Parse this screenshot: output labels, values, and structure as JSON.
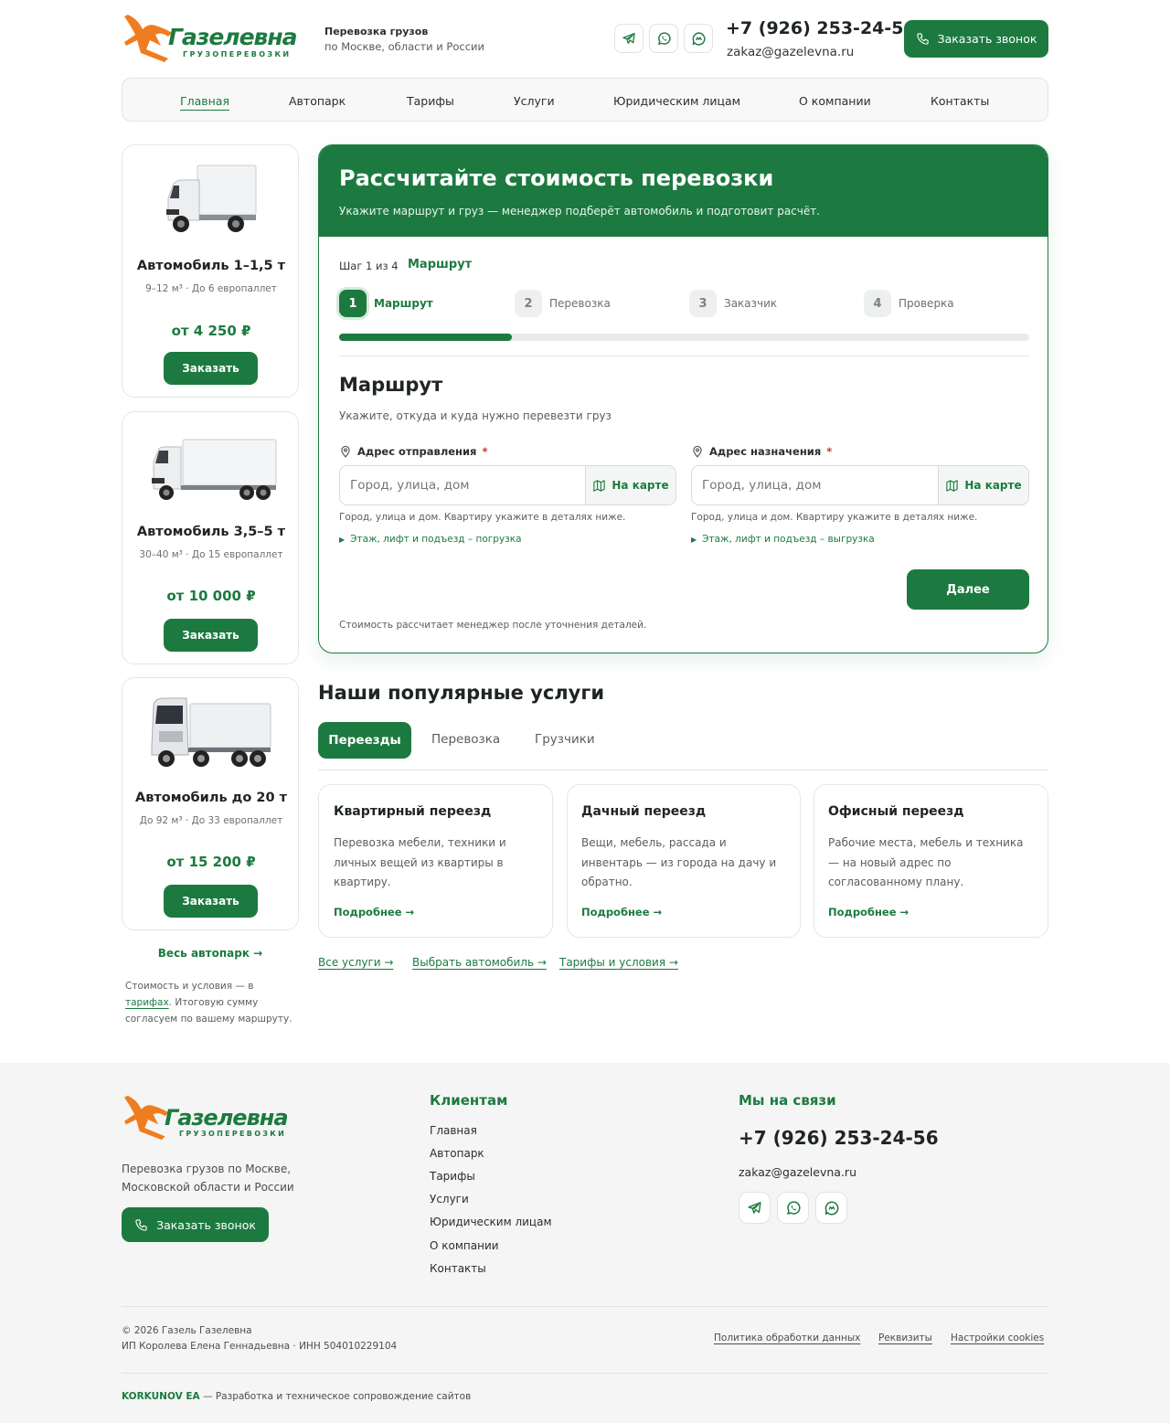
{
  "header": {
    "logo_name": "Газелевна",
    "logo_sub": "ГРУЗОПЕРЕВОЗКИ",
    "tagline_1": "Перевозка грузов",
    "tagline_2": "по Москве, области и России",
    "phone": "+7 (926) 253-24-56",
    "email": "zakaz@gazelevna.ru",
    "callback": "Заказать звонок",
    "social_icons": [
      "telegram-icon",
      "whatsapp-icon",
      "max-messenger-icon"
    ]
  },
  "nav": [
    "Главная",
    "Автопарк",
    "Тарифы",
    "Услуги",
    "Юридическим лицам",
    "О компании",
    "Контакты"
  ],
  "fleet": [
    {
      "title": "Автомобиль 1–1,5 т",
      "spec": "9–12 м³ · До 6 европаллет",
      "price": "от 4 250 ₽",
      "button": "Заказать"
    },
    {
      "title": "Автомобиль 3,5–5 т",
      "spec": "30–40 м³ · До 15 европаллет",
      "price": "от 10 000 ₽",
      "button": "Заказать"
    },
    {
      "title": "Автомобиль до 20 т",
      "spec": "До 92 м³ · До 33 европаллет",
      "price": "от 15 200 ₽",
      "button": "Заказать"
    }
  ],
  "fleet_link": "Весь автопарк →",
  "fleet_note_1": "Стоимость и условия — в",
  "fleet_note_link": "тарифах",
  "fleet_note_2": ". Итоговую сумму",
  "fleet_note_3": "согласуем по вашему маршруту.",
  "calc": {
    "title": "Рассчитайте стоимость перевозки",
    "subtitle": "Укажите маршрут и груз — менеджер подберёт автомобиль и подготовит расчёт.",
    "step_counter": "Шаг 1 из 4",
    "step_current": "Маршрут",
    "steps": [
      {
        "num": "1",
        "label": "Маршрут"
      },
      {
        "num": "2",
        "label": "Перевозка"
      },
      {
        "num": "3",
        "label": "Заказчик"
      },
      {
        "num": "4",
        "label": "Проверка"
      }
    ],
    "progress": 0.25,
    "section_title": "Маршрут",
    "section_hint": "Укажите, откуда и куда нужно перевезти груз",
    "from_label": "Адрес отправления",
    "to_label": "Адрес назначения",
    "required_mark": "*",
    "placeholder": "Город, улица, дом",
    "map_button": "На карте",
    "field_hint": "Город, улица и дом. Квартиру укажите в деталях ниже.",
    "from_details": "Этаж, лифт и подъезд – погрузка",
    "to_details": "Этаж, лифт и подъезд – выгрузка",
    "next": "Далее",
    "footnote": "Стоимость рассчитает менеджер после уточнения деталей."
  },
  "services": {
    "title": "Наши популярные услуги",
    "tabs": [
      "Переезды",
      "Перевозка",
      "Грузчики"
    ],
    "cards": [
      {
        "title": "Квартирный переезд",
        "lines": [
          "Перевозка мебели, техники и",
          "личных вещей из квартиры в",
          "квартиру."
        ],
        "link": "Подробнее →"
      },
      {
        "title": "Дачный переезд",
        "lines": [
          "Вещи, мебель, рассада и",
          "инвентарь — из города на дачу и",
          "обратно."
        ],
        "link": "Подробнее →"
      },
      {
        "title": "Офисный переезд",
        "lines": [
          "Рабочие места, мебель и техника",
          "— на новый адрес по",
          "согласованному плану."
        ],
        "link": "Подробнее →"
      }
    ],
    "links": [
      "Все услуги →",
      "Выбрать автомобиль →",
      "Тарифы и условия →"
    ]
  },
  "footer": {
    "desc_1": "Перевозка грузов по Москве,",
    "desc_2": "Московской области и России",
    "callback": "Заказать звонок",
    "clients_title": "Клиентам",
    "clients_links": [
      "Главная",
      "Автопарк",
      "Тарифы",
      "Услуги",
      "Юридическим лицам",
      "О компании",
      "Контакты"
    ],
    "contact_title": "Мы на связи",
    "phone": "+7 (926) 253-24-56",
    "email": "zakaz@gazelevna.ru",
    "copyright": "© 2026 Газель Газелевна",
    "legal": "ИП Королева Елена Геннадьевна · ИНН 504010229104",
    "policy_links": [
      "Политика обработки данных",
      "Реквизиты",
      "Настройки cookies"
    ],
    "dev_name": "KORKUNOV EA",
    "dev_text": " — Разработка и техническое сопровождение сайтов"
  },
  "colors": {
    "brand_green": "#1c7a40",
    "brand_orange": "#ef7d1f",
    "footer_bg": "#f4f5f4"
  }
}
